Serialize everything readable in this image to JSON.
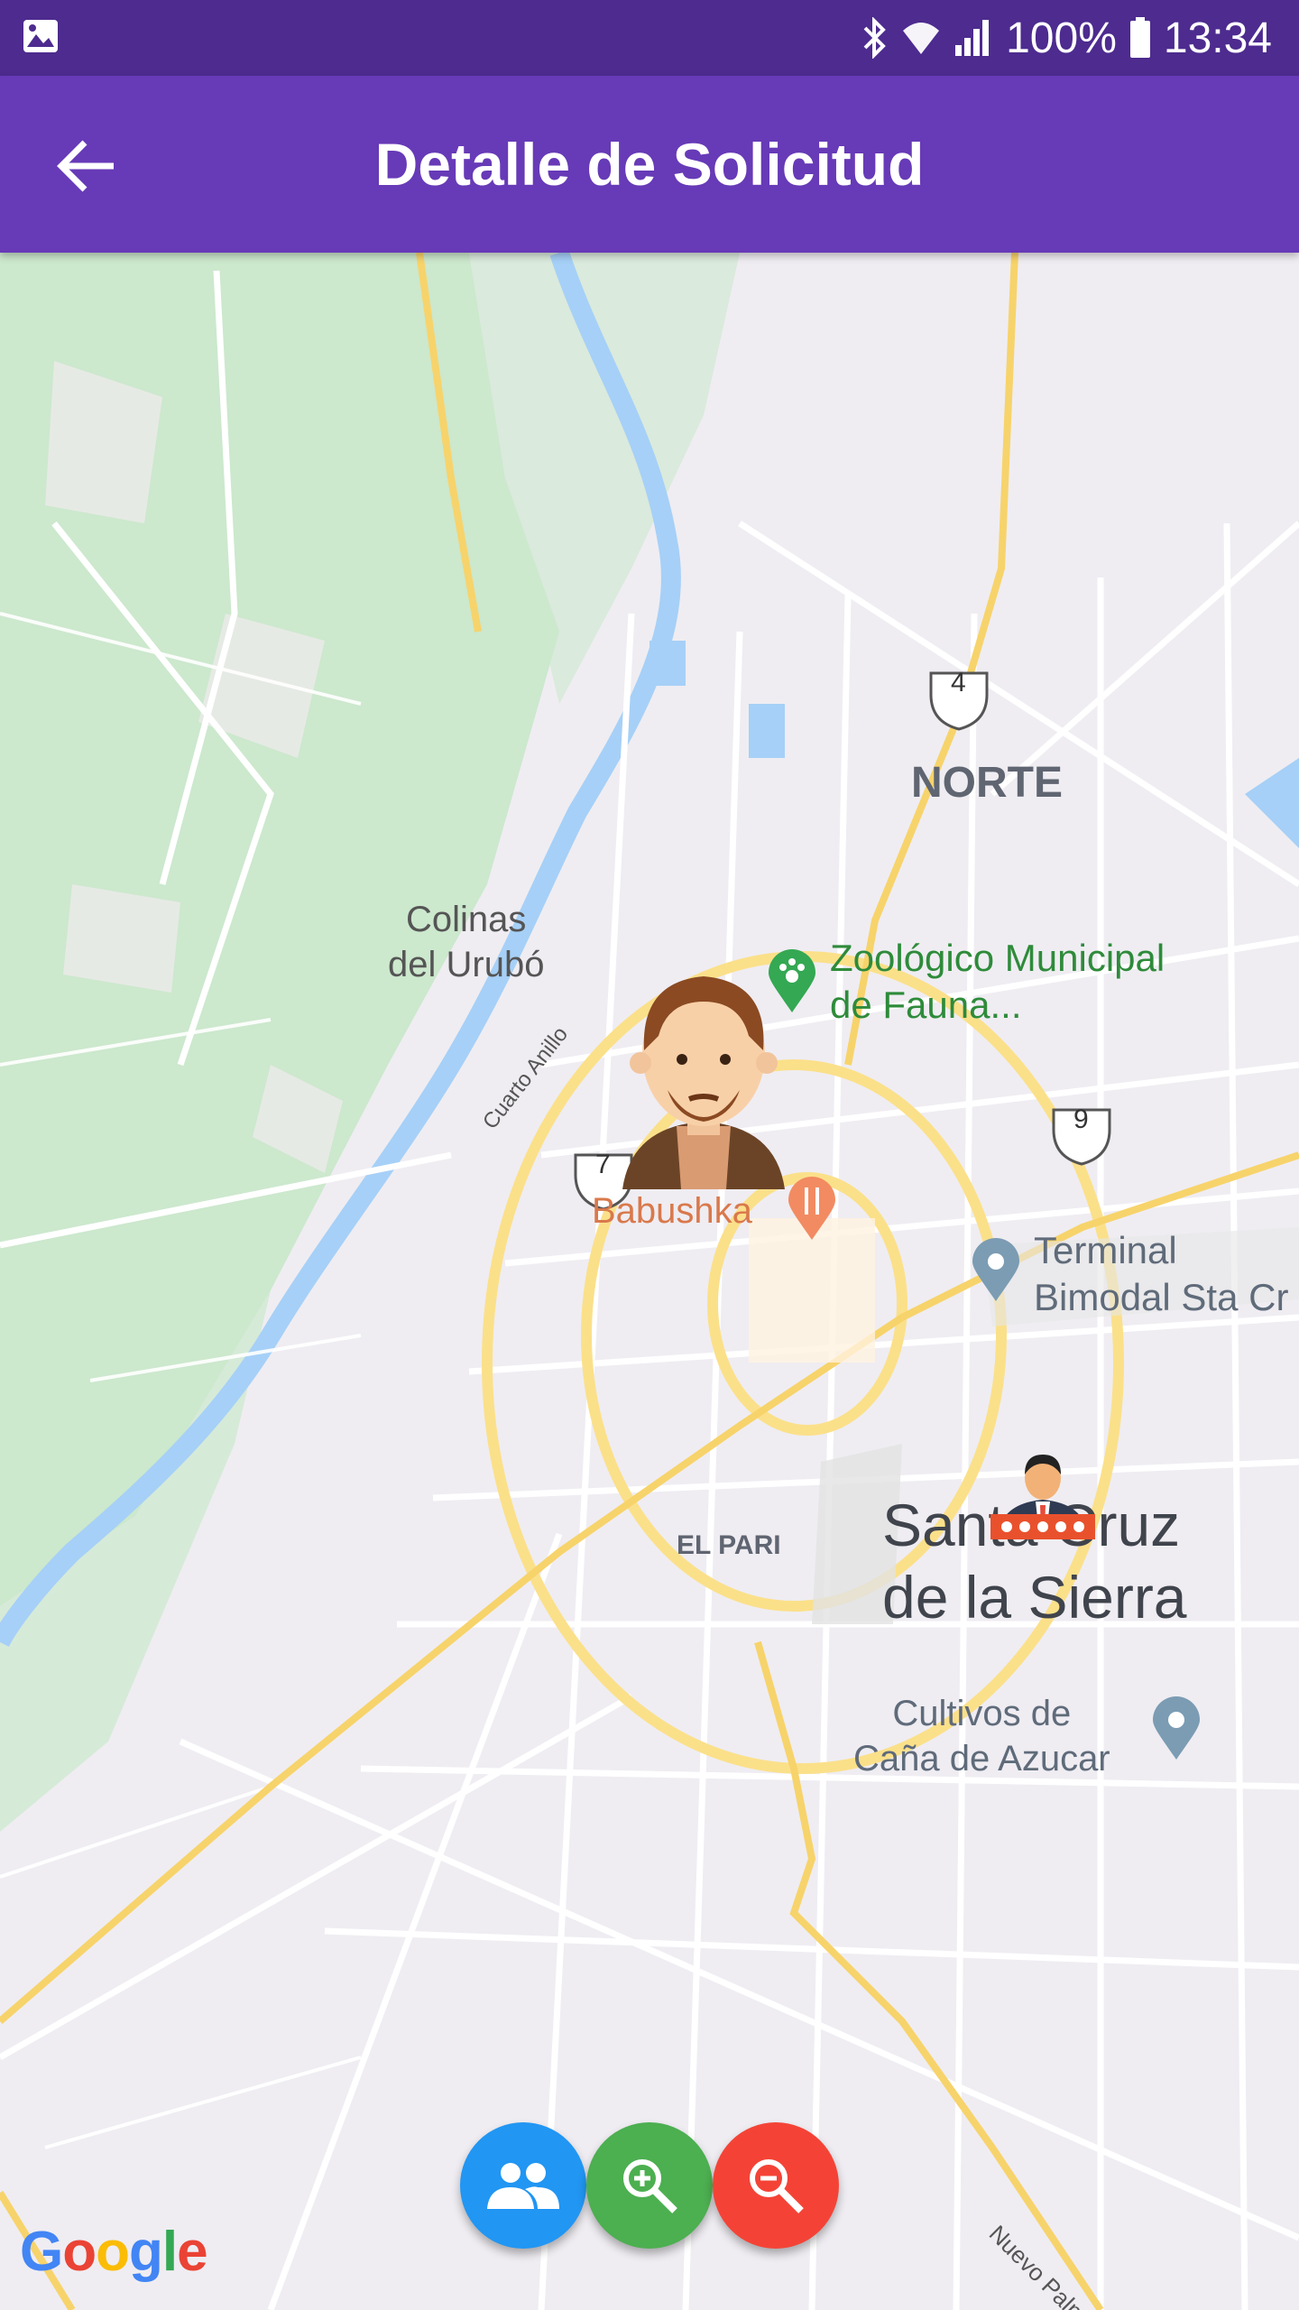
{
  "status_bar": {
    "battery": "100%",
    "time": "13:34",
    "icons": [
      "image-icon",
      "bluetooth-icon",
      "wifi-icon",
      "signal-icon",
      "battery-icon"
    ]
  },
  "app_bar": {
    "title": "Detalle de Solicitud",
    "back_icon": "arrow-back-icon",
    "color": "#673ab7"
  },
  "map": {
    "labels": {
      "norte": "NORTE",
      "colinas_1": "Colinas",
      "colinas_2": "del Urubó",
      "zoo_1": "Zoológico Municipal",
      "zoo_2": "de Fauna...",
      "babushka": "Babushka",
      "cuarto_anillo": "Cuarto Anillo",
      "terminal_1": "Terminal",
      "terminal_2": "Bimodal Sta Cr",
      "city_1": "Santa Cruz",
      "city_2": "de la Sierra",
      "el_pari": "EL PARI",
      "cultivos_1": "Cultivos de",
      "cultivos_2": "Caña de Azucar",
      "nuevo_palmar": "Nuevo Palmar",
      "route_4": "4",
      "route_7": "7",
      "route_9": "9"
    },
    "markers": [
      "client-avatar-marker",
      "driver-avatar-marker"
    ],
    "attribution": "Google"
  },
  "fabs": [
    {
      "name": "users-button",
      "icon": "group-icon",
      "color": "#2196f3"
    },
    {
      "name": "zoom-in-button",
      "icon": "zoom-in-icon",
      "color": "#4caf50"
    },
    {
      "name": "zoom-out-button",
      "icon": "zoom-out-icon",
      "color": "#f44336"
    }
  ]
}
